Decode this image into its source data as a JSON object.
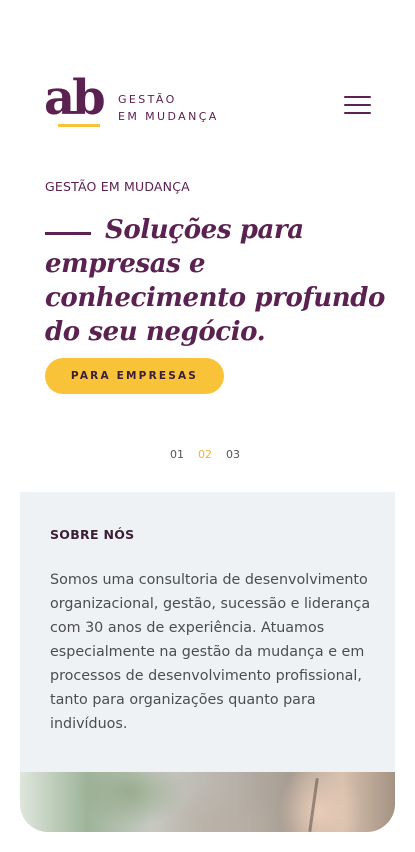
{
  "brand": {
    "logo_mark": "ab",
    "logo_line1": "GESTÃO",
    "logo_line2": "EM MUDANÇA",
    "primary_color": "#5b2150",
    "accent_color": "#f8c239"
  },
  "header": {
    "menu_icon": "hamburger-menu-icon"
  },
  "hero": {
    "eyebrow": "GESTÃO EM MUDANÇA",
    "title": "Soluções para empresas e conhecimento profundo do seu negócio.",
    "cta_label": "PARA EMPRESAS"
  },
  "slider": {
    "pages": [
      "01",
      "02",
      "03"
    ],
    "active_index": 1
  },
  "about": {
    "title": "SOBRE NÓS",
    "text": "Somos uma consultoria de desenvolvimento organizacional, gestão, sucessão e liderança com 30 anos de experiência. Atuamos especialmente na gestão da mudança e em processos de desenvolvimento profissional, tanto para organizações quanto para indivíduos."
  }
}
